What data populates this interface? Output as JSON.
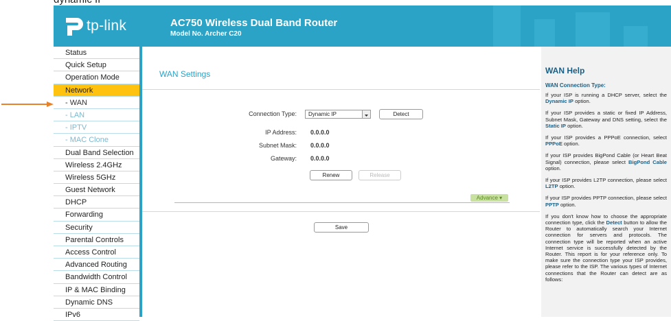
{
  "page_top_fragment": "dynamic IP",
  "header": {
    "logo_text": "tp-link",
    "title": "AC750 Wireless Dual Band Router",
    "model": "Model No. Archer C20"
  },
  "sidebar": {
    "items": [
      {
        "label": "Status"
      },
      {
        "label": "Quick Setup"
      },
      {
        "label": "Operation Mode"
      },
      {
        "label": "Network"
      },
      {
        "label": "- WAN"
      },
      {
        "label": "- LAN"
      },
      {
        "label": "- IPTV"
      },
      {
        "label": "- MAC Clone"
      },
      {
        "label": "Dual Band Selection"
      },
      {
        "label": "Wireless 2.4GHz"
      },
      {
        "label": "Wireless 5GHz"
      },
      {
        "label": "Guest Network"
      },
      {
        "label": "DHCP"
      },
      {
        "label": "Forwarding"
      },
      {
        "label": "Security"
      },
      {
        "label": "Parental Controls"
      },
      {
        "label": "Access Control"
      },
      {
        "label": "Advanced Routing"
      },
      {
        "label": "Bandwidth Control"
      },
      {
        "label": "IP & MAC Binding"
      },
      {
        "label": "Dynamic DNS"
      },
      {
        "label": "IPv6"
      }
    ],
    "active_index": 3,
    "current_sub_index": 4,
    "arrow_color": "#e8822a"
  },
  "main": {
    "section_title": "WAN Settings",
    "connection_type_label": "Connection Type:",
    "connection_type_value": "Dynamic IP",
    "detect_label": "Detect",
    "ip_address_label": "IP Address:",
    "ip_address_value": "0.0.0.0",
    "subnet_mask_label": "Subnet Mask:",
    "subnet_mask_value": "0.0.0.0",
    "gateway_label": "Gateway:",
    "gateway_value": "0.0.0.0",
    "renew_label": "Renew",
    "release_label": "Release",
    "advance_label": "Advance",
    "save_label": "Save"
  },
  "help": {
    "title": "WAN Help",
    "subtitle": "WAN Connection Type:",
    "p1_a": "If your ISP is running a DHCP server, select the ",
    "p1_hl": "Dynamic IP",
    "p1_b": " option.",
    "p2_a": "If your ISP provides a static or fixed IP Address, Subnet Mask, Gateway and DNS setting, select the ",
    "p2_hl": "Static IP",
    "p2_b": " option.",
    "p3_a": "If your ISP provides a PPPoE connection, select ",
    "p3_hl": "PPPoE",
    "p3_b": " option.",
    "p4_a": "If your ISP provides BigPond Cable (or Heart Beat Signal) connection, please select ",
    "p4_hl": "BigPond Cable",
    "p4_b": " option.",
    "p5_a": "If your ISP provides L2TP connection, please select ",
    "p5_hl": "L2TP",
    "p5_b": " option.",
    "p6_a": "If your ISP provides PPTP connection, please select ",
    "p6_hl": "PPTP",
    "p6_b": " option.",
    "p7_a": "If you don't know how to choose the appropriate connection type, click the ",
    "p7_hl": "Detect",
    "p7_b": " button to allow the Router to automatically search your Internet connection for servers and protocols. The connection type will be reported when an active Internet service is successfully detected by the Router. This report is for your reference only. To make sure the connection type your ISP provides, please refer to the ISP. The various types of Internet connections that the Router can detect are as follows:"
  },
  "colors": {
    "accent": "#2aa3c6",
    "active_menu": "#ffc20e",
    "help_heading": "#1a5f85"
  }
}
